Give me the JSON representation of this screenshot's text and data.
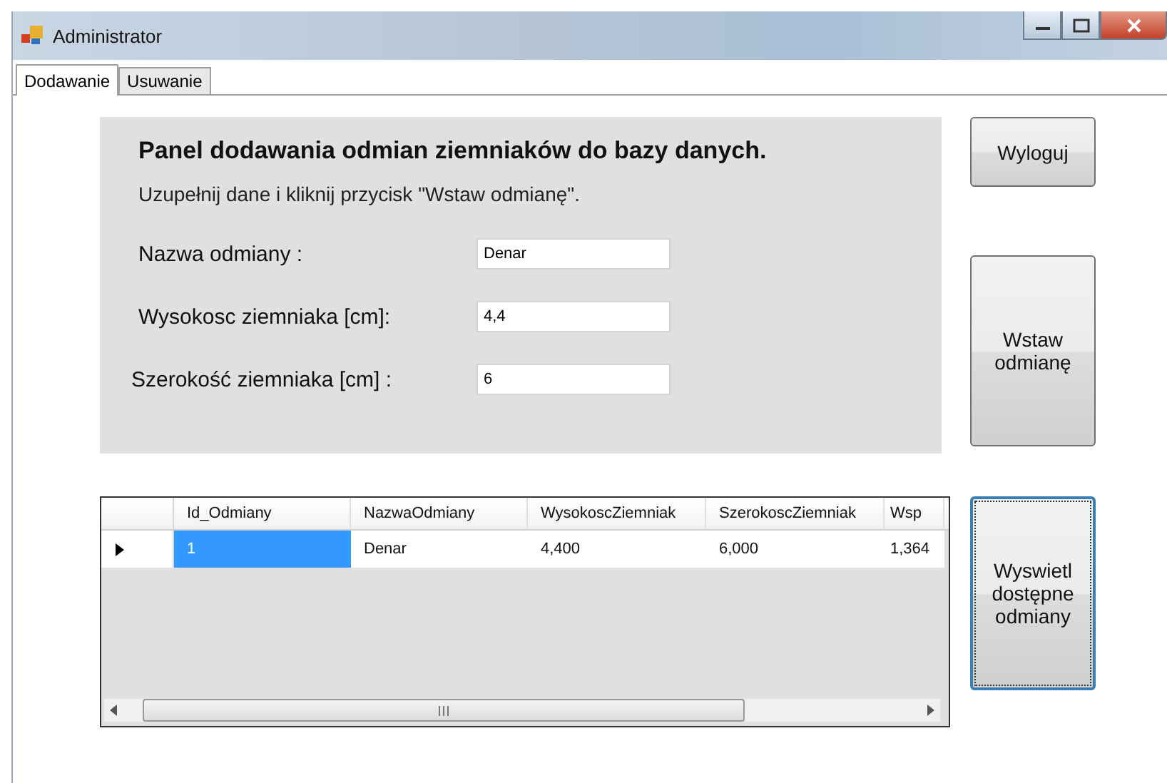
{
  "window": {
    "title": "Administrator"
  },
  "tabs": [
    {
      "label": "Dodawanie",
      "selected": true
    },
    {
      "label": "Usuwanie",
      "selected": false
    }
  ],
  "panel": {
    "heading": "Panel dodawania odmian ziemniaków do bazy danych.",
    "instructions": "Uzupełnij dane i kliknij przycisk \"Wstaw odmianę\".",
    "fields": [
      {
        "label": "Nazwa odmiany :",
        "value": "Denar"
      },
      {
        "label": "Wysokosc ziemniaka [cm]:",
        "value": "4,4"
      },
      {
        "label": "Szerokość ziemniaka [cm] :",
        "value": "6"
      }
    ]
  },
  "grid": {
    "columns": [
      "Id_Odmiany",
      "NazwaOdmiany",
      "WysokoscZiemniak",
      "SzerokoscZiemniak",
      "Wsp"
    ],
    "rows": [
      {
        "current": true,
        "cells": [
          {
            "text": "1",
            "selected": true
          },
          {
            "text": "Denar",
            "selected": false
          },
          {
            "text": "4,400",
            "selected": false
          },
          {
            "text": "6,000",
            "selected": false
          },
          {
            "text": "1,364",
            "selected": false
          }
        ]
      }
    ]
  },
  "buttons": [
    {
      "label": "Wyloguj",
      "focused": false
    },
    {
      "label": "Wstaw odmianę",
      "focused": false
    },
    {
      "label": "Wyswietl dostępne odmiany",
      "focused": true
    }
  ]
}
